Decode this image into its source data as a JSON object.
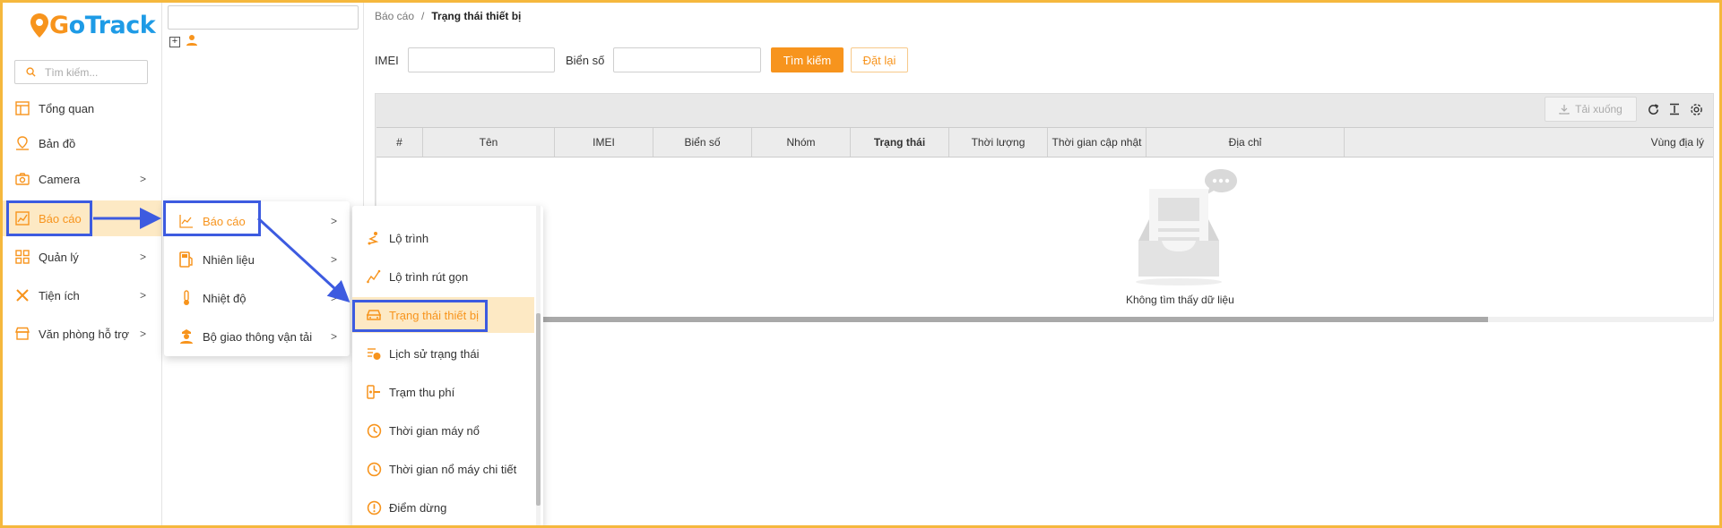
{
  "app": {
    "logo_g": "G",
    "logo_rest": "oTrack"
  },
  "sidebar": {
    "search_placeholder": "Tìm kiếm...",
    "items": [
      {
        "label": "Tổng quan",
        "icon": "layout-icon"
      },
      {
        "label": "Bản đồ",
        "icon": "map-pin-icon"
      },
      {
        "label": "Camera",
        "icon": "camera-icon"
      },
      {
        "label": "Báo cáo",
        "icon": "chart-icon"
      },
      {
        "label": "Quản lý",
        "icon": "grid-icon"
      },
      {
        "label": "Tiện ích",
        "icon": "tools-icon"
      },
      {
        "label": "Văn phòng hỗ trợ",
        "icon": "store-icon"
      }
    ]
  },
  "breadcrumb": {
    "parent": "Báo cáo",
    "separator": "/",
    "current": "Trạng thái thiết bị"
  },
  "filters": {
    "imei_label": "IMEI",
    "plate_label": "Biển số",
    "search_button": "Tìm kiếm",
    "reset_button": "Đặt lại"
  },
  "toolbar": {
    "download_label": "Tải xuống"
  },
  "table": {
    "columns": [
      "#",
      "Tên",
      "IMEI",
      "Biển số",
      "Nhóm",
      "Trạng thái",
      "Thời lượng",
      "Thời gian cập nhật",
      "Địa chỉ",
      "Vùng địa lý"
    ],
    "empty_text": "Không tìm thấy dữ liệu"
  },
  "submenu1": {
    "items": [
      {
        "label": "Báo cáo",
        "icon": "chart-line-icon"
      },
      {
        "label": "Nhiên liệu",
        "icon": "fuel-icon"
      },
      {
        "label": "Nhiệt độ",
        "icon": "thermometer-icon"
      },
      {
        "label": "Bộ giao thông vận tải",
        "icon": "officer-icon"
      }
    ]
  },
  "submenu2": {
    "items": [
      {
        "label": "Lộ trình",
        "icon": "route-icon"
      },
      {
        "label": "Lộ trình rút gọn",
        "icon": "trend-icon"
      },
      {
        "label": "Trạng thái thiết bị",
        "icon": "car-icon"
      },
      {
        "label": "Lịch sử trạng thái",
        "icon": "history-icon"
      },
      {
        "label": "Trạm thu phí",
        "icon": "toll-icon"
      },
      {
        "label": "Thời gian máy nổ",
        "icon": "clock-icon"
      },
      {
        "label": "Thời gian nổ máy chi tiết",
        "icon": "clock-icon"
      },
      {
        "label": "Điểm dừng",
        "icon": "alert-icon"
      }
    ]
  },
  "colors": {
    "accent": "#f7941d",
    "brand_blue": "#1e9be6",
    "active_bg": "#fde9c4",
    "highlight": "#3d5be0"
  }
}
